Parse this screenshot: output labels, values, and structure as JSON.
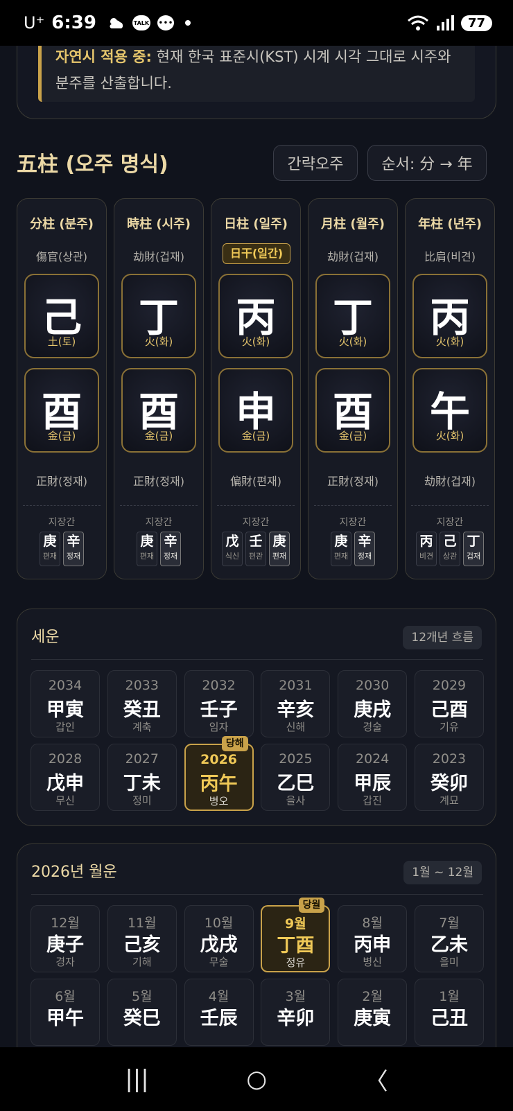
{
  "status": {
    "carrier": "U⁺",
    "time": "6:39",
    "talk": "TALK",
    "battery": "77"
  },
  "notice": {
    "bold": "자연시 적용 중:",
    "text": " 현재 한국 표준시(KST) 시계 시각 그대로 시주와 분주를 산출합니다."
  },
  "section": {
    "title": "五柱 (오주 명식)",
    "btn_simple": "간략오주",
    "btn_order": "순서: 分 → 年"
  },
  "pillars": [
    {
      "title": "分柱 (분주)",
      "sub": "傷官(상관)",
      "stem": "己",
      "stem_el": "土(토)",
      "branch": "酉",
      "branch_el": "金(금)",
      "bottom": "正財(정재)",
      "jlabel": "지장간",
      "jj": [
        {
          "h": "庚",
          "s": "편재"
        },
        {
          "h": "辛",
          "s": "정재"
        }
      ]
    },
    {
      "title": "時柱 (시주)",
      "sub": "劫財(겁재)",
      "stem": "丁",
      "stem_el": "火(화)",
      "branch": "酉",
      "branch_el": "金(금)",
      "bottom": "正財(정재)",
      "jlabel": "지장간",
      "jj": [
        {
          "h": "庚",
          "s": "편재"
        },
        {
          "h": "辛",
          "s": "정재"
        }
      ]
    },
    {
      "title": "日柱 (일주)",
      "sub": "日干(일간)",
      "stem": "丙",
      "stem_el": "火(화)",
      "branch": "申",
      "branch_el": "金(금)",
      "bottom": "偏財(편재)",
      "jlabel": "지장간",
      "jj": [
        {
          "h": "戊",
          "s": "식신"
        },
        {
          "h": "壬",
          "s": "편관"
        },
        {
          "h": "庚",
          "s": "편재"
        }
      ]
    },
    {
      "title": "月柱 (월주)",
      "sub": "劫財(겁재)",
      "stem": "丁",
      "stem_el": "火(화)",
      "branch": "酉",
      "branch_el": "金(금)",
      "bottom": "正財(정재)",
      "jlabel": "지장간",
      "jj": [
        {
          "h": "庚",
          "s": "편재"
        },
        {
          "h": "辛",
          "s": "정재"
        }
      ]
    },
    {
      "title": "年柱 (년주)",
      "sub": "比肩(비견)",
      "stem": "丙",
      "stem_el": "火(화)",
      "branch": "午",
      "branch_el": "火(화)",
      "bottom": "劫財(겁재)",
      "jlabel": "지장간",
      "jj": [
        {
          "h": "丙",
          "s": "비견"
        },
        {
          "h": "己",
          "s": "상관"
        },
        {
          "h": "丁",
          "s": "겁재"
        }
      ]
    }
  ],
  "seun": {
    "title": "세운",
    "badge": "12개년 흐름",
    "current_tag": "당해",
    "cells": [
      {
        "top": "2034",
        "gz": "甲寅",
        "ko": "갑인"
      },
      {
        "top": "2033",
        "gz": "癸丑",
        "ko": "계축"
      },
      {
        "top": "2032",
        "gz": "壬子",
        "ko": "임자"
      },
      {
        "top": "2031",
        "gz": "辛亥",
        "ko": "신해"
      },
      {
        "top": "2030",
        "gz": "庚戌",
        "ko": "경술"
      },
      {
        "top": "2029",
        "gz": "己酉",
        "ko": "기유"
      },
      {
        "top": "2028",
        "gz": "戊申",
        "ko": "무신"
      },
      {
        "top": "2027",
        "gz": "丁未",
        "ko": "정미"
      },
      {
        "top": "2026",
        "gz": "丙午",
        "ko": "병오",
        "current": true
      },
      {
        "top": "2025",
        "gz": "乙巳",
        "ko": "을사"
      },
      {
        "top": "2024",
        "gz": "甲辰",
        "ko": "갑진"
      },
      {
        "top": "2023",
        "gz": "癸卯",
        "ko": "계묘"
      }
    ]
  },
  "wolun": {
    "title": "2026년 월운",
    "badge": "1월 ~ 12월",
    "current_tag": "당월",
    "cells": [
      {
        "top": "12월",
        "gz": "庚子",
        "ko": "경자"
      },
      {
        "top": "11월",
        "gz": "己亥",
        "ko": "기해"
      },
      {
        "top": "10월",
        "gz": "戊戌",
        "ko": "무술"
      },
      {
        "top": "9월",
        "gz": "丁酉",
        "ko": "정유",
        "current": true
      },
      {
        "top": "8월",
        "gz": "丙申",
        "ko": "병신"
      },
      {
        "top": "7월",
        "gz": "乙未",
        "ko": "을미"
      },
      {
        "top": "6월",
        "gz": "甲午",
        "ko": ""
      },
      {
        "top": "5월",
        "gz": "癸巳",
        "ko": ""
      },
      {
        "top": "4월",
        "gz": "壬辰",
        "ko": ""
      },
      {
        "top": "3월",
        "gz": "辛卯",
        "ko": ""
      },
      {
        "top": "2월",
        "gz": "庚寅",
        "ko": ""
      },
      {
        "top": "1월",
        "gz": "己丑",
        "ko": ""
      }
    ]
  },
  "nav": {
    "recent": "|||",
    "home": "○",
    "back": "〈"
  }
}
